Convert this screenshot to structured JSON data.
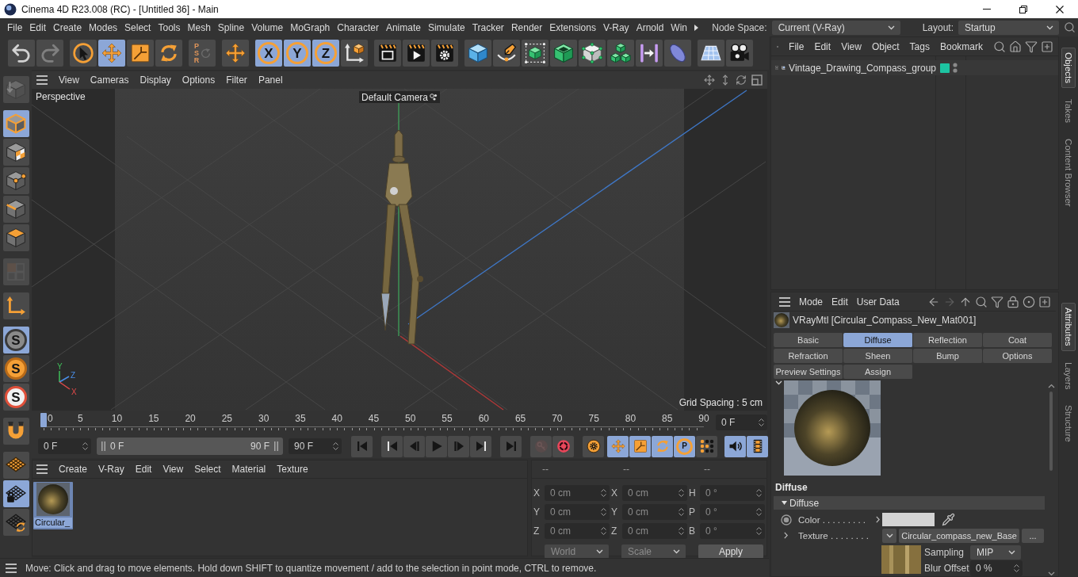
{
  "window": {
    "title": "Cinema 4D R23.008 (RC) - [Untitled 36] - Main"
  },
  "menu_bar": {
    "items": [
      "File",
      "Edit",
      "Create",
      "Modes",
      "Select",
      "Tools",
      "Mesh",
      "Spline",
      "Volume",
      "MoGraph",
      "Character",
      "Animate",
      "Simulate",
      "Tracker",
      "Render",
      "Extensions",
      "V-Ray",
      "Arnold",
      "Win"
    ],
    "node_space": {
      "label": "Node Space:",
      "value": "Current (V-Ray)"
    },
    "layout": {
      "label": "Layout:",
      "value": "Startup"
    }
  },
  "toolbar": {
    "groups": [
      [
        {
          "kind": "undo",
          "selected": false,
          "disabled": false
        },
        {
          "kind": "redo",
          "selected": false,
          "disabled": true
        }
      ],
      [
        {
          "kind": "select",
          "selected": false,
          "disabled": false
        },
        {
          "kind": "move",
          "selected": true,
          "disabled": false
        },
        {
          "kind": "scale",
          "selected": false,
          "disabled": false
        },
        {
          "kind": "rotate",
          "selected": false,
          "disabled": false
        }
      ],
      [
        {
          "kind": "psr",
          "label": "PSR",
          "selected": false,
          "disabled": true
        }
      ],
      [
        {
          "kind": "world",
          "selected": false,
          "disabled": false
        }
      ],
      [
        {
          "kind": "axis",
          "label": "X",
          "selected": true,
          "disabled": false
        },
        {
          "kind": "axis",
          "label": "Y",
          "selected": true,
          "disabled": false
        },
        {
          "kind": "axis",
          "label": "Z",
          "selected": true,
          "disabled": false
        },
        {
          "kind": "coord",
          "selected": false,
          "disabled": false
        }
      ],
      [
        {
          "kind": "render-view",
          "selected": false,
          "disabled": false
        },
        {
          "kind": "render",
          "selected": false,
          "disabled": false
        },
        {
          "kind": "render-settings",
          "selected": false,
          "disabled": false
        }
      ],
      [
        {
          "kind": "cube",
          "selected": false,
          "disabled": false
        },
        {
          "kind": "pen",
          "selected": false,
          "disabled": false
        },
        {
          "kind": "subdiv",
          "selected": false,
          "disabled": false
        },
        {
          "kind": "extrude",
          "selected": false,
          "disabled": false
        },
        {
          "kind": "cloner",
          "selected": false,
          "disabled": false
        },
        {
          "kind": "array",
          "selected": false,
          "disabled": false
        },
        {
          "kind": "deformer",
          "selected": false,
          "disabled": false
        },
        {
          "kind": "field",
          "selected": false,
          "disabled": false
        }
      ],
      [
        {
          "kind": "floor",
          "selected": false,
          "disabled": false
        },
        {
          "kind": "camera",
          "selected": false,
          "disabled": false
        }
      ]
    ]
  },
  "side_toolbar": {
    "groups": [
      [
        {
          "kind": "editable",
          "selected": false,
          "disabled": true
        }
      ],
      [
        {
          "kind": "model",
          "selected": true,
          "disabled": false
        },
        {
          "kind": "texture",
          "selected": false,
          "disabled": false
        },
        {
          "kind": "point",
          "selected": false,
          "disabled": false
        },
        {
          "kind": "edge",
          "selected": false,
          "disabled": false
        },
        {
          "kind": "polygon",
          "selected": false,
          "disabled": false
        }
      ],
      [
        {
          "kind": "uv",
          "selected": false,
          "disabled": true
        }
      ],
      [
        {
          "kind": "axis-mode",
          "selected": false,
          "disabled": false
        }
      ],
      [
        {
          "kind": "solo-view",
          "label": "S",
          "selected": true,
          "disabled": false
        },
        {
          "kind": "solo-single",
          "label": "S",
          "selected": false,
          "disabled": false
        },
        {
          "kind": "solo-hierarchy",
          "label": "S",
          "selected": false,
          "disabled": false
        }
      ],
      [
        {
          "kind": "magnet",
          "selected": false,
          "disabled": false
        }
      ],
      [
        {
          "kind": "workplane",
          "selected": false,
          "disabled": false
        },
        {
          "kind": "workplane-lock",
          "selected": true,
          "disabled": false
        },
        {
          "kind": "workplane-rotate",
          "selected": false,
          "disabled": false
        }
      ]
    ]
  },
  "viewport": {
    "menu": [
      "View",
      "Cameras",
      "Display",
      "Options",
      "Filter",
      "Panel"
    ],
    "view_name": "Perspective",
    "camera": "Default Camera",
    "grid_spacing": "Grid Spacing : 5 cm",
    "gizmo": {
      "y": "Y",
      "z": "Z",
      "x": "X"
    }
  },
  "timeline": {
    "ticks": [
      "0",
      "5",
      "10",
      "15",
      "20",
      "25",
      "30",
      "35",
      "40",
      "45",
      "50",
      "55",
      "60",
      "65",
      "70",
      "75",
      "80",
      "85",
      "90"
    ],
    "level": 0,
    "frame": "0 F"
  },
  "transport": {
    "start_field": "0 F",
    "range": {
      "start": "0 F",
      "end": "90 F",
      "level": 1
    },
    "end_field": "90 F",
    "groups": [
      [
        {
          "kind": "go-start",
          "selected": false,
          "disabled": false
        }
      ],
      [
        {
          "kind": "prev-key",
          "selected": false,
          "disabled": false
        },
        {
          "kind": "prev-frame",
          "selected": false,
          "disabled": false
        },
        {
          "kind": "play",
          "selected": false,
          "disabled": false
        },
        {
          "kind": "next-frame",
          "selected": false,
          "disabled": false
        },
        {
          "kind": "next-key",
          "selected": false,
          "disabled": false
        }
      ],
      [
        {
          "kind": "go-end",
          "selected": false,
          "disabled": false
        }
      ],
      [
        {
          "kind": "record",
          "selected": false,
          "disabled": true
        },
        {
          "kind": "autokey",
          "selected": false,
          "disabled": false
        }
      ],
      [
        {
          "kind": "key-settings",
          "selected": false,
          "disabled": false
        }
      ],
      [
        {
          "kind": "key-move",
          "selected": true,
          "disabled": false
        },
        {
          "kind": "key-scale",
          "selected": true,
          "disabled": false
        },
        {
          "kind": "key-rotate",
          "selected": true,
          "disabled": false
        },
        {
          "kind": "key-param",
          "label": "P",
          "selected": true,
          "disabled": false
        },
        {
          "kind": "key-pla",
          "selected": false,
          "disabled": false
        }
      ],
      [
        {
          "kind": "sound",
          "selected": true,
          "disabled": false
        },
        {
          "kind": "film",
          "selected": true,
          "disabled": false
        }
      ]
    ]
  },
  "materials": {
    "menu": [
      "Create",
      "V-Ray",
      "Edit",
      "View",
      "Select",
      "Material",
      "Texture"
    ],
    "items": [
      {
        "name": "Circular_",
        "selected": true
      }
    ]
  },
  "coordinates": {
    "disabled": true,
    "columns": [
      {
        "header": "--",
        "fields": [
          {
            "axis": "X",
            "value": "0 cm"
          },
          {
            "axis": "Y",
            "value": "0 cm"
          },
          {
            "axis": "Z",
            "value": "0 cm"
          }
        ]
      },
      {
        "header": "--",
        "fields": [
          {
            "axis": "X",
            "value": "0 cm"
          },
          {
            "axis": "Y",
            "value": "0 cm"
          },
          {
            "axis": "Z",
            "value": "0 cm"
          }
        ]
      },
      {
        "header": "--",
        "fields": [
          {
            "axis": "H",
            "value": "0 °"
          },
          {
            "axis": "P",
            "value": "0 °"
          },
          {
            "axis": "B",
            "value": "0 °"
          }
        ]
      }
    ],
    "dropdowns": [
      "World",
      "Scale"
    ],
    "apply": "Apply"
  },
  "status_bar": {
    "message": "Move: Click and drag to move elements. Hold down SHIFT to quantize movement / add to the selection in point mode, CTRL to remove."
  },
  "objects": {
    "menu": [
      "File",
      "Edit",
      "View",
      "Object",
      "Tags",
      "Bookmark"
    ],
    "tree": [
      {
        "name": "Vintage_Drawing_Compass_group",
        "expanded": false,
        "selected": false,
        "color": "#1dc4a2"
      }
    ]
  },
  "side_tabs": {
    "top": [
      {
        "label": "Objects",
        "selected": true
      },
      {
        "label": "Takes",
        "selected": false
      },
      {
        "label": "Content Browser",
        "selected": false
      }
    ],
    "bottom": [
      {
        "label": "Attributes",
        "selected": true
      },
      {
        "label": "Layers",
        "selected": false
      },
      {
        "label": "Structure",
        "selected": false
      }
    ]
  },
  "attributes": {
    "menu": [
      "Mode",
      "Edit",
      "User Data"
    ],
    "title": "VRayMtl [Circular_Compass_New_Mat001]",
    "tabs": [
      {
        "label": "Basic",
        "selected": false
      },
      {
        "label": "Diffuse",
        "selected": true
      },
      {
        "label": "Reflection",
        "selected": false
      },
      {
        "label": "Coat",
        "selected": false
      },
      {
        "label": "Refraction",
        "selected": false
      },
      {
        "label": "Sheen",
        "selected": false
      },
      {
        "label": "Bump",
        "selected": false
      },
      {
        "label": "Options",
        "selected": false
      },
      {
        "label": "Preview Settings",
        "selected": false
      },
      {
        "label": "Assign",
        "selected": false
      }
    ],
    "section": "Diffuse",
    "group": {
      "label": "Diffuse",
      "expanded": true
    },
    "color_row": {
      "label": "Color . . . . . . . . .",
      "color": "#d3d3d3"
    },
    "texture_row": {
      "label": "Texture . . . . . . . .",
      "shader": "Circular_compass_new_Base",
      "more": "..."
    },
    "sampling": {
      "label": "Sampling",
      "value": "MIP"
    },
    "blur_offset": {
      "label": "Blur Offset",
      "value": "0 %"
    }
  }
}
